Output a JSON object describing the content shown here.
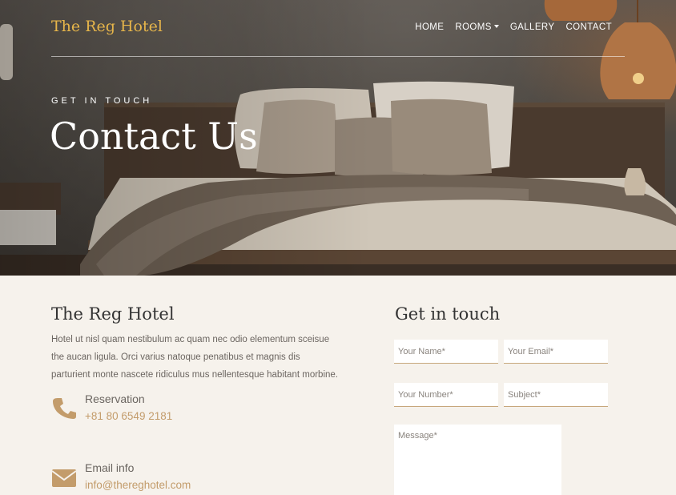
{
  "header": {
    "brand": "The Reg Hotel",
    "nav": [
      {
        "label": "HOME"
      },
      {
        "label": "ROOMS",
        "has_dropdown": true
      },
      {
        "label": "GALLERY"
      },
      {
        "label": "CONTACT"
      }
    ]
  },
  "hero": {
    "eyebrow": "GET IN TOUCH",
    "title": "Contact Us"
  },
  "about": {
    "title": "The Reg Hotel",
    "text": "Hotel ut nisl quam nestibulum ac quam nec odio elementum sceisue the aucan ligula. Orci varius natoque penatibus et magnis dis parturient monte nascete ridiculus mus nellentesque habitant morbine.",
    "reservation": {
      "label": "Reservation",
      "value": "+81 80 6549 2181",
      "icon": "phone-icon"
    },
    "email": {
      "label": "Email info",
      "value": "info@thereghotel.com",
      "icon": "envelope-icon"
    }
  },
  "form": {
    "title": "Get in touch",
    "name_placeholder": "Your Name*",
    "email_placeholder": "Your Email*",
    "number_placeholder": "Your Number*",
    "subject_placeholder": "Subject*",
    "message_placeholder": "Message*"
  },
  "colors": {
    "accent": "#c39c6b",
    "brand_gold": "#e6b54a",
    "content_bg": "#f6f2ec"
  }
}
